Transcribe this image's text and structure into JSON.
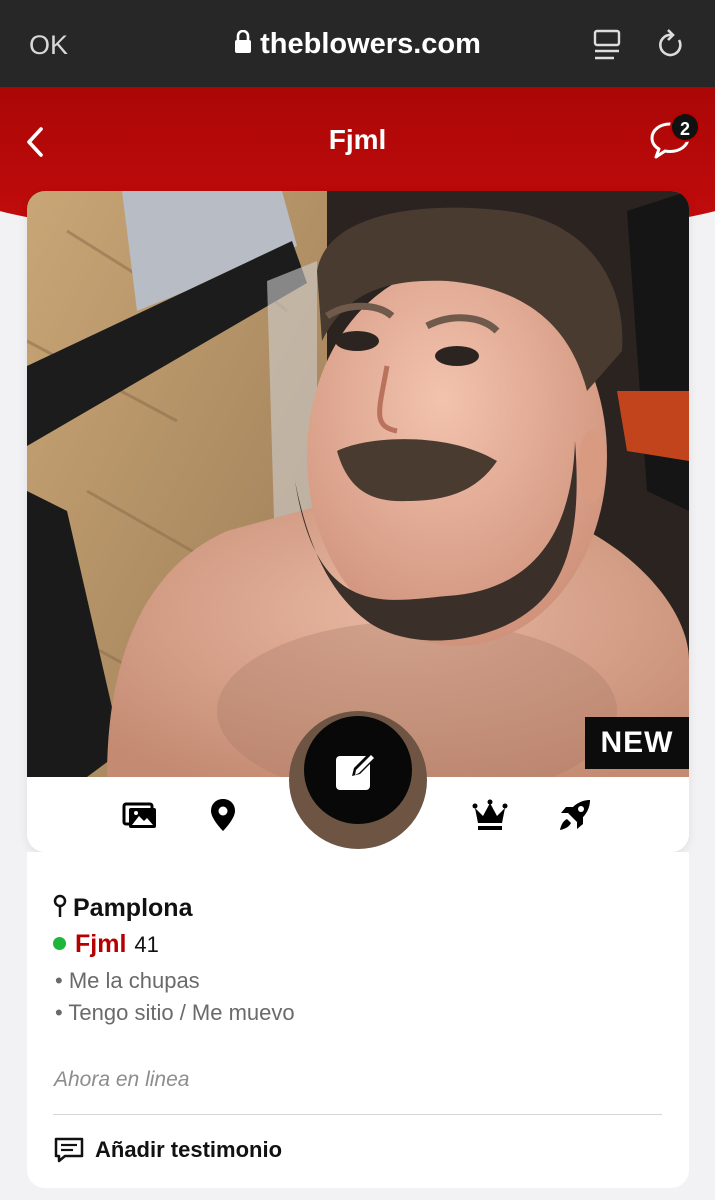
{
  "browser": {
    "done_label": "OK",
    "url": "theblowers.com",
    "icons": [
      "lock-icon",
      "reader-icon",
      "reload-icon"
    ]
  },
  "header": {
    "title": "Fjml",
    "chat_badge_count": "2",
    "icons": [
      "back-icon",
      "chat-icon"
    ]
  },
  "photo": {
    "badge": "NEW",
    "actions": [
      "photos-icon",
      "location-icon",
      "edit-icon",
      "crown-icon",
      "rocket-icon"
    ]
  },
  "profile": {
    "city": "Pamplona",
    "username": "Fjml",
    "age": "41",
    "tags": [
      "Me la chupas",
      "Tengo sitio / Me muevo"
    ],
    "status": "Ahora en linea",
    "testimonial_label": "Añadir testimonio"
  },
  "colors": {
    "brand_red": "#b50000",
    "online_green": "#1fb43c",
    "browser_bar": "#272727"
  }
}
